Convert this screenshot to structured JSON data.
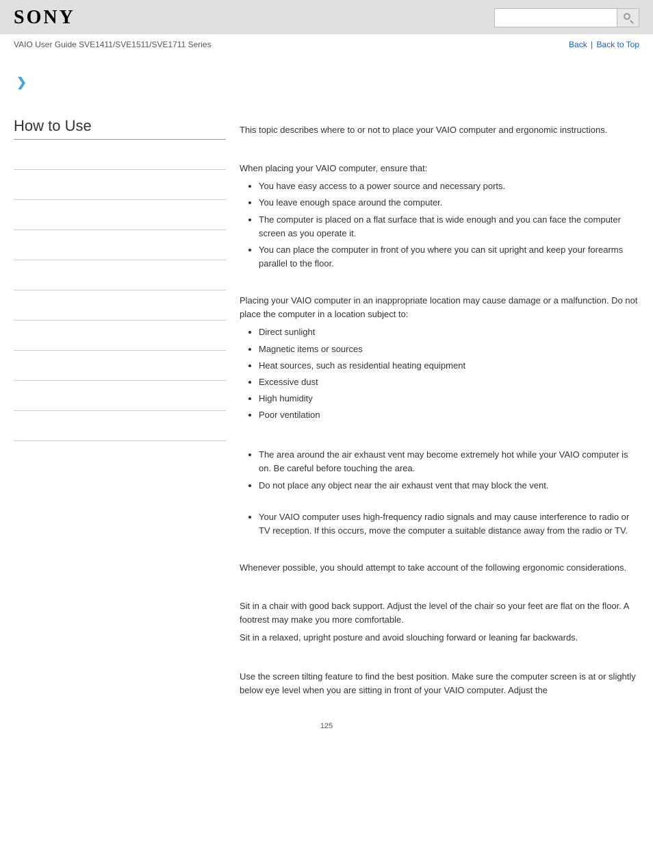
{
  "header": {
    "logo": "SONY",
    "search_placeholder": ""
  },
  "subheader": {
    "breadcrumb": "VAIO User Guide SVE1411/SVE1511/SVE1711 Series",
    "back": "Back",
    "back_to_top": "Back to Top"
  },
  "sidebar": {
    "title": "How to Use"
  },
  "content": {
    "intro": "This topic describes where to or not to place your VAIO computer and ergonomic instructions.",
    "placing_intro": "When placing your VAIO computer, ensure that:",
    "placing_list": [
      "You have easy access to a power source and necessary ports.",
      "You leave enough space around the computer.",
      "The computer is placed on a flat surface that is wide enough and you can face the computer screen as you operate it.",
      "You can place the computer in front of you where you can sit upright and keep your forearms parallel to the floor."
    ],
    "avoid_intro": "Placing your VAIO computer in an inappropriate location may cause damage or a malfunction. Do not place the computer in a location subject to:",
    "avoid_list": [
      "Direct sunlight",
      "Magnetic items or sources",
      "Heat sources, such as residential heating equipment",
      "Excessive dust",
      "High humidity",
      "Poor ventilation"
    ],
    "vent_list": [
      "The area around the air exhaust vent may become extremely hot while your VAIO computer is on. Be careful before touching the area.",
      "Do not place any object near the air exhaust vent that may block the vent."
    ],
    "rf_list": [
      "Your VAIO computer uses high-frequency radio signals and may cause interference to radio or TV reception. If this occurs, move the computer a suitable distance away from the radio or TV."
    ],
    "ergo_intro": "Whenever possible, you should attempt to take account of the following ergonomic considerations.",
    "chair1": "Sit in a chair with good back support. Adjust the level of the chair so your feet are flat on the floor. A footrest may make you more comfortable.",
    "chair2": "Sit in a relaxed, upright posture and avoid slouching forward or leaning far backwards.",
    "screen": "Use the screen tilting feature to find the best position. Make sure the computer screen is at or slightly below eye level when you are sitting in front of your VAIO computer. Adjust the"
  },
  "page_number": "125"
}
